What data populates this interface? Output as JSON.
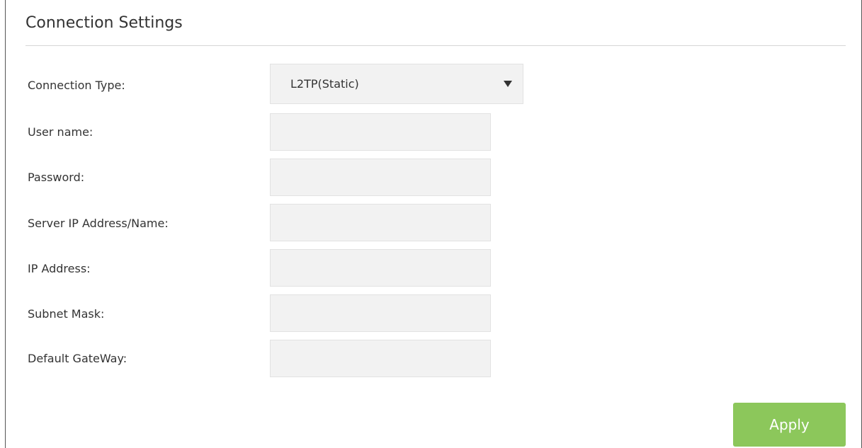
{
  "section": {
    "title": "Connection Settings"
  },
  "fields": {
    "connection_type": {
      "label": "Connection Type:",
      "value": "L2TP(Static)",
      "icon": "chevron-down-icon"
    },
    "username": {
      "label": "User name:",
      "value": "",
      "placeholder": ""
    },
    "password": {
      "label": "Password:",
      "value": "",
      "placeholder": ""
    },
    "server": {
      "label": "Server IP Address/Name:",
      "value": "",
      "placeholder": ""
    },
    "ip_address": {
      "label": "IP Address:",
      "value": "",
      "placeholder": ""
    },
    "subnet_mask": {
      "label": "Subnet Mask:",
      "value": "",
      "placeholder": ""
    },
    "gateway": {
      "label": "Default GateWay:",
      "value": "",
      "placeholder": ""
    }
  },
  "actions": {
    "apply_label": "Apply"
  },
  "colors": {
    "apply_button": "#8cc75b",
    "input_background": "#f2f2f2",
    "divider": "#d6d6d6",
    "text": "#333333"
  }
}
